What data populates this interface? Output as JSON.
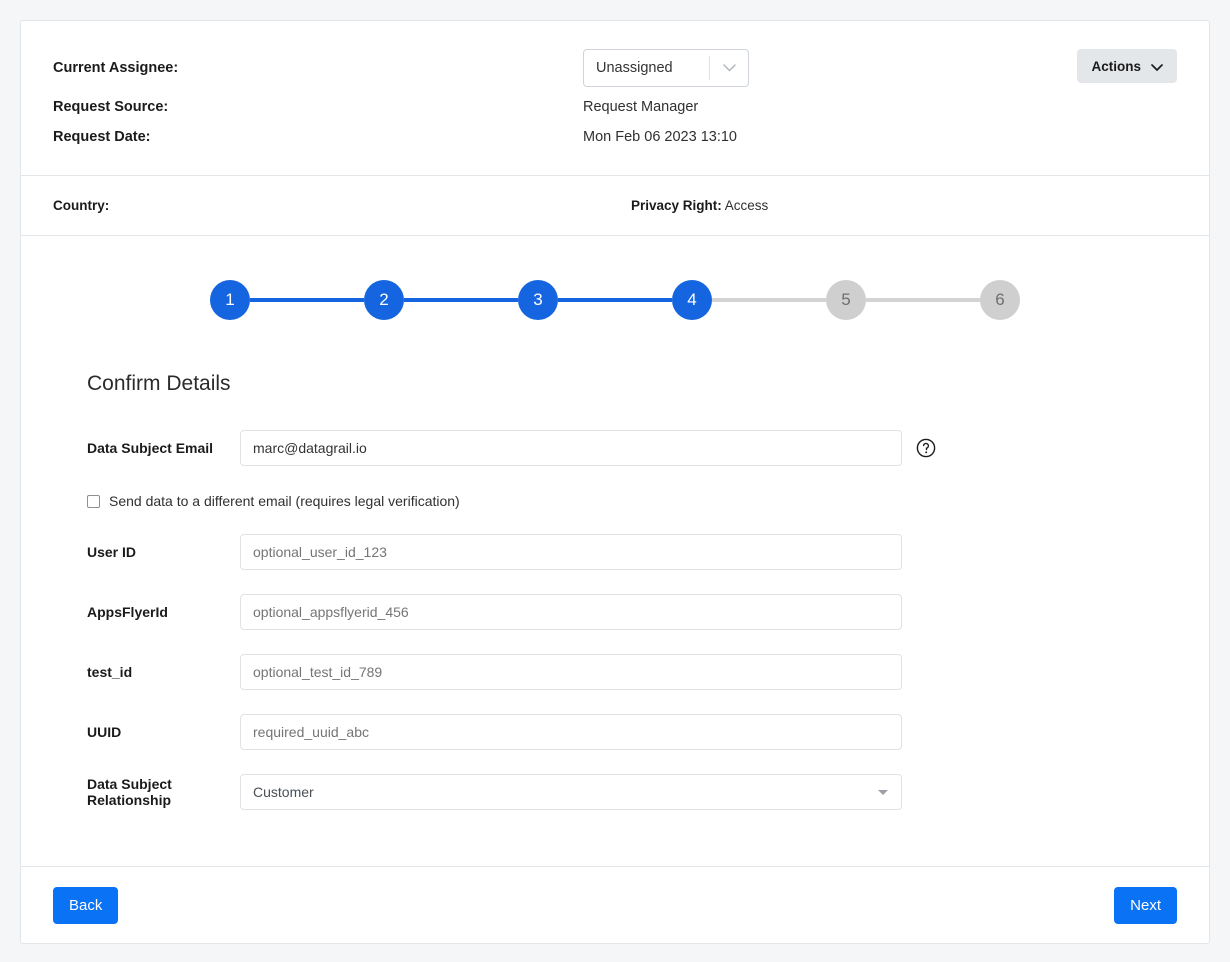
{
  "header": {
    "assignee_label": "Current Assignee:",
    "assignee_value": "Unassigned",
    "source_label": "Request Source:",
    "source_value": "Request Manager",
    "date_label": "Request Date:",
    "date_value": "Mon Feb 06 2023 13:10",
    "actions_label": "Actions"
  },
  "band": {
    "country_label": "Country:",
    "country_value": "",
    "privacy_label": "Privacy Right:",
    "privacy_value": "Access"
  },
  "stepper": {
    "steps": [
      {
        "number": "1",
        "state": "done"
      },
      {
        "number": "2",
        "state": "done"
      },
      {
        "number": "3",
        "state": "done"
      },
      {
        "number": "4",
        "state": "done"
      },
      {
        "number": "5",
        "state": "todo"
      },
      {
        "number": "6",
        "state": "todo"
      }
    ],
    "active_step": "4",
    "total_steps": "6"
  },
  "form": {
    "title": "Confirm Details",
    "email_label": "Data Subject Email",
    "email_value": "marc@datagrail.io",
    "checkbox_label": "Send data to a different email (requires legal verification)",
    "checkbox_checked": "false",
    "user_id_label": "User ID",
    "user_id_placeholder": "optional_user_id_123",
    "appsflyer_label": "AppsFlyerId",
    "appsflyer_placeholder": "optional_appsflyerid_456",
    "test_id_label": "test_id",
    "test_id_placeholder": "optional_test_id_789",
    "uuid_label": "UUID",
    "uuid_placeholder": "required_uuid_abc",
    "relationship_label": "Data Subject Relationship",
    "relationship_value": "Customer"
  },
  "footer": {
    "back_label": "Back",
    "next_label": "Next"
  },
  "colors": {
    "accent": "#0a72f5",
    "step_done": "#1565e0",
    "step_todo": "#cfcfcf",
    "page_bg": "#f4f6f8"
  }
}
